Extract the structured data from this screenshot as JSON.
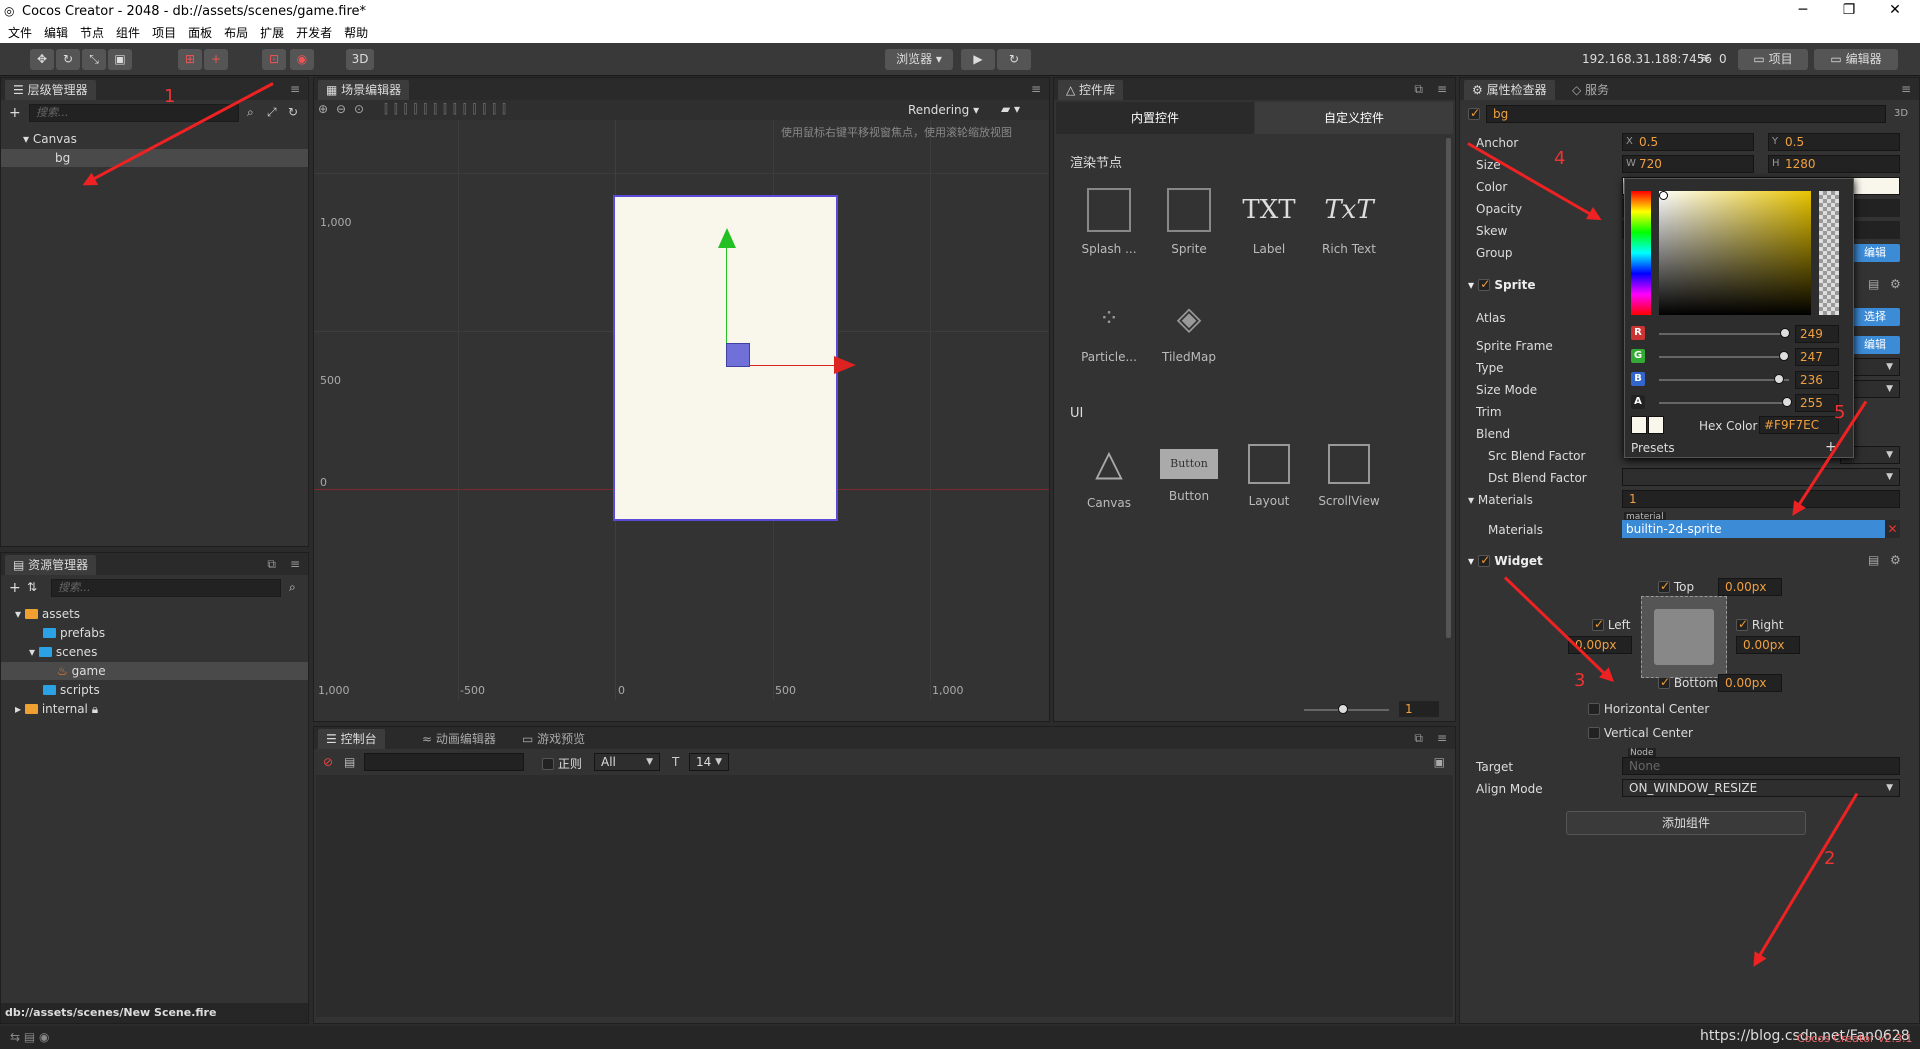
{
  "window": {
    "title": "Cocos Creator - 2048 - db://assets/scenes/game.fire*",
    "min": "─",
    "max": "❐",
    "close": "✕"
  },
  "menu": [
    "文件",
    "编辑",
    "节点",
    "组件",
    "项目",
    "面板",
    "布局",
    "扩展",
    "开发者",
    "帮助"
  ],
  "toolbar": {
    "btn_3d": "3D",
    "browser": "浏览器 ▾",
    "ip": "192.168.31.188:7456",
    "wifi_count": "0",
    "project": "项目",
    "editor": "编辑器"
  },
  "hierarchy": {
    "tab": "层级管理器",
    "search_placeholder": "搜索...",
    "canvas": "Canvas",
    "bg": "bg"
  },
  "assets": {
    "tab": "资源管理器",
    "search_placeholder": "搜索...",
    "items": [
      {
        "name": "assets"
      },
      {
        "name": "prefabs"
      },
      {
        "name": "scenes"
      },
      {
        "name": "game"
      },
      {
        "name": "scripts"
      },
      {
        "name": "internal"
      }
    ],
    "status": "db://assets/scenes/New Scene.fire"
  },
  "scene": {
    "tab": "场景编辑器",
    "rendering": "Rendering",
    "hint": "使用鼠标右键平移视窗焦点，使用滚轮缩放视图",
    "y_ticks": [
      "1,000",
      "500",
      "0"
    ],
    "x_ticks": [
      "1,000",
      "-500",
      "0",
      "500",
      "1,000"
    ],
    "zoom": "1",
    "canvas_color": "#F9F7EC"
  },
  "widgets": {
    "tab": "控件库",
    "tab_builtin": "内置控件",
    "tab_custom": "自定义控件",
    "render_title": "渲染节点",
    "ui_title": "UI",
    "render_items": [
      "Splash ...",
      "Sprite",
      "Label",
      "Rich Text",
      "Particle...",
      "TiledMap"
    ],
    "ui_items": [
      "Canvas",
      "Button",
      "Layout",
      "ScrollView"
    ],
    "txt_glyph": "TXT",
    "rich_glyph": "TxT",
    "button_glyph": "Button"
  },
  "console": {
    "tabs": [
      "控制台",
      "动画编辑器",
      "游戏预览"
    ],
    "regex": "正则",
    "level": "All",
    "font_size": "14"
  },
  "inspector": {
    "tab": "属性检查器",
    "tab2": "服务",
    "node_name": "bg",
    "three_d": "3D",
    "anchor_label": "Anchor",
    "anchor_x": "0.5",
    "anchor_y": "0.5",
    "size_label": "Size",
    "size_w": "720",
    "size_h": "1280",
    "color_label": "Color",
    "opacity_label": "Opacity",
    "skew_label": "Skew",
    "group_label": "Group",
    "edit": "编辑",
    "sprite": {
      "title": "Sprite",
      "atlas": "Atlas",
      "sprite_frame": "Sprite Frame",
      "type": "Type",
      "size_mode": "Size Mode",
      "trim": "Trim",
      "blend": "Blend",
      "src_blend": "Src Blend Factor",
      "dst_blend": "Dst Blend Factor",
      "select": "选择",
      "edit": "编辑",
      "materials": "Materials",
      "materials_count": "1",
      "material_tag": "material",
      "material_value": "builtin-2d-sprite"
    },
    "widget": {
      "title": "Widget",
      "top": "Top",
      "top_val": "0.00px",
      "left": "Left",
      "left_val": "0.00px",
      "right": "Right",
      "right_val": "0.00px",
      "bottom": "Bottom",
      "bottom_val": "0.00px",
      "hcenter": "Horizontal Center",
      "vcenter": "Vertical Center",
      "target": "Target",
      "target_tag": "Node",
      "target_val": "None",
      "align_mode": "Align Mode",
      "align_val": "ON_WINDOW_RESIZE"
    },
    "add_component": "添加组件"
  },
  "picker": {
    "r": "249",
    "g": "247",
    "b": "236",
    "a": "255",
    "hex_label": "Hex Color",
    "hex": "#F9F7EC",
    "presets": "Presets",
    "plus": "+"
  },
  "annotations": [
    "1",
    "2",
    "3",
    "4",
    "5"
  ],
  "watermark": "https://blog.csdn.net/Fan0628",
  "version": "Cocos Creator v2.3.1"
}
